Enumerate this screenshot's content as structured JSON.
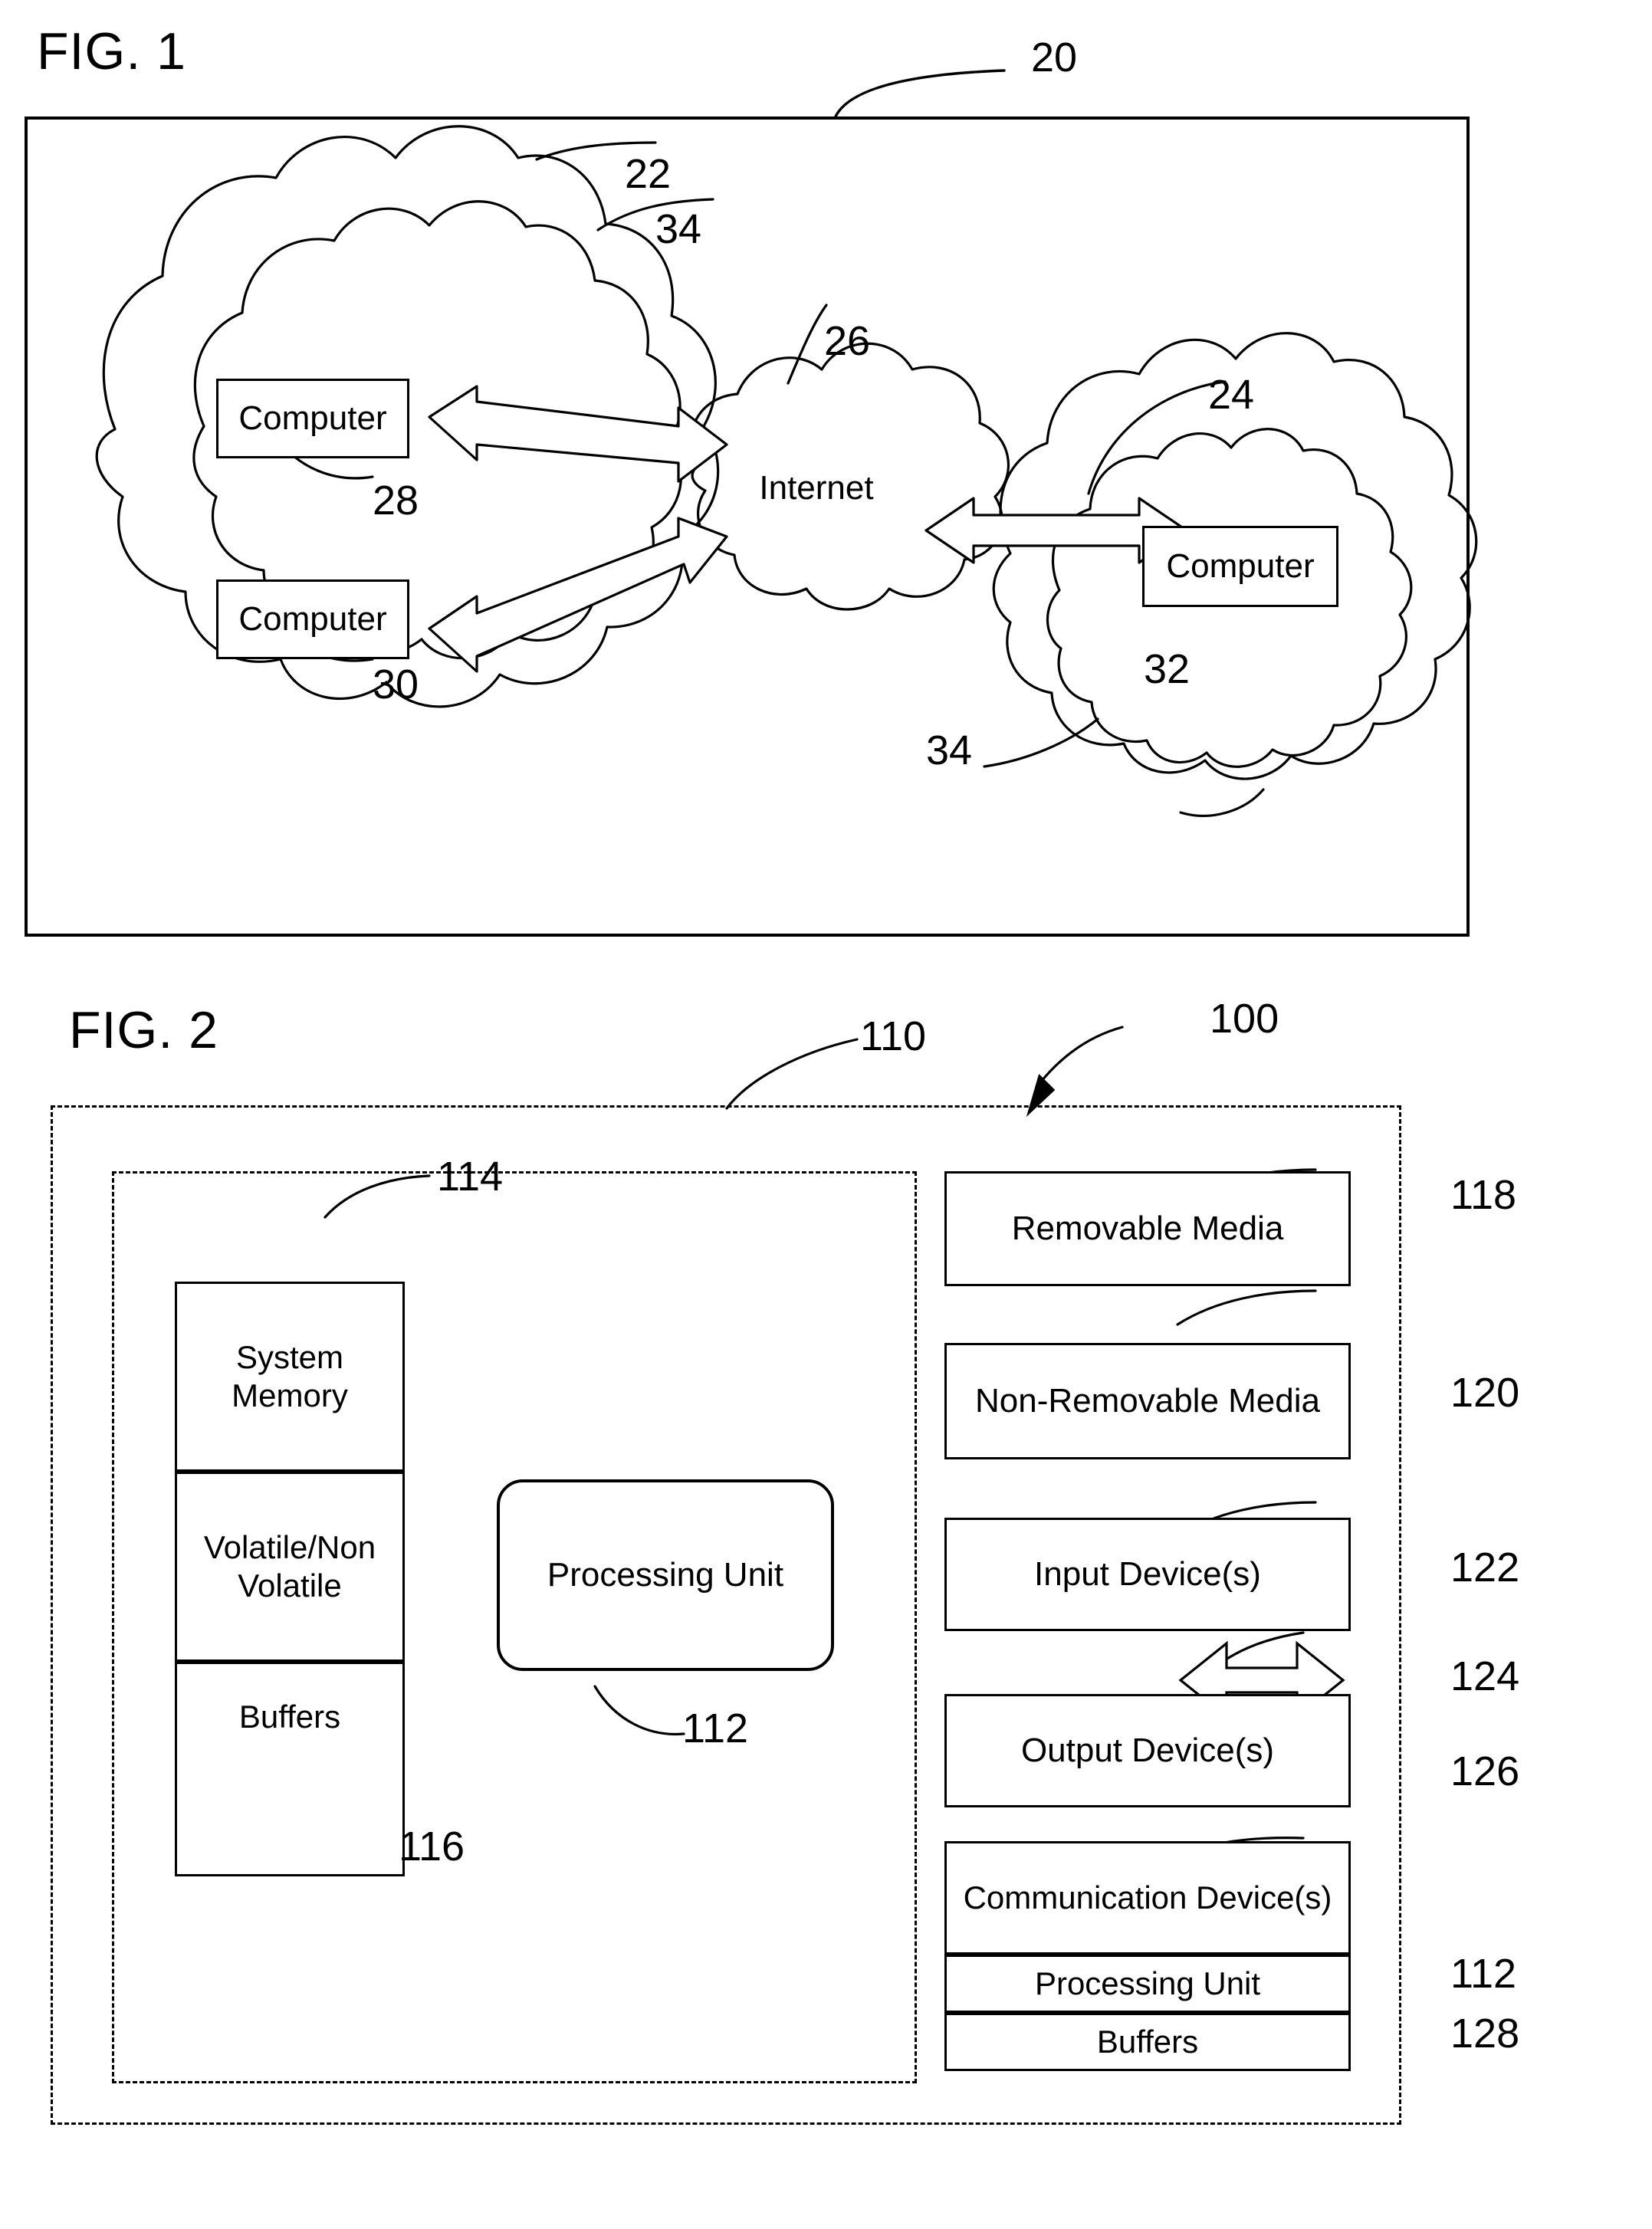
{
  "figures": [
    {
      "title": "FIG. 1",
      "frame_ref": "20",
      "refs": {
        "cloud_upper_left": "22",
        "cloud_right": "24",
        "internet": "26",
        "computer_top": "28",
        "computer_bottom": "30",
        "computer_right": "32",
        "network_left": "34",
        "network_right": "34"
      },
      "nodes": {
        "computer_top_label": "Computer",
        "computer_bottom_label": "Computer",
        "computer_right_label": "Computer",
        "internet_label": "Internet"
      }
    },
    {
      "title": "FIG. 2",
      "refs": {
        "outer_system": "100",
        "inner_host": "110",
        "processing_unit": "112",
        "system_memory": "114",
        "memory_buffers": "116",
        "removable_media": "118",
        "non_removable_media": "120",
        "input_devices": "122",
        "output_devices": "124",
        "communication_devices": "126",
        "comm_processing_unit": "112",
        "comm_buffers": "128"
      },
      "memory_stack": [
        {
          "label": "System Memory"
        },
        {
          "label": "Volatile/Non Volatile"
        },
        {
          "label": "Buffers"
        }
      ],
      "processing_unit_label": "Processing Unit",
      "right_column": [
        {
          "label": "Removable Media",
          "ref": "118"
        },
        {
          "label": "Non-Removable Media",
          "ref": "120"
        },
        {
          "label": "Input Device(s)",
          "ref": "122"
        },
        {
          "label": "Output Device(s)",
          "ref": "124"
        }
      ],
      "communication_stack": [
        {
          "label": "Communication Device(s)",
          "ref": "126"
        },
        {
          "label": "Processing Unit",
          "ref": "112"
        },
        {
          "label": "Buffers",
          "ref": "128"
        }
      ]
    }
  ],
  "colors": {
    "ink": "#000000",
    "paper": "#ffffff"
  }
}
